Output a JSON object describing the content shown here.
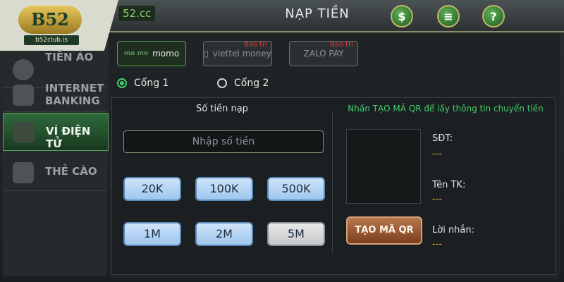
{
  "header": {
    "url_text": "52.cc",
    "title": "NẠP TIỀN",
    "icons": [
      "dollar-shield-icon",
      "list-icon",
      "help-icon"
    ]
  },
  "logo": {
    "brand": "B52",
    "site": "b52club.is"
  },
  "sidebar": {
    "items": [
      {
        "label": "TIỀN ẢO",
        "icon": "bitcoin-icon",
        "active": false
      },
      {
        "label": "INTERNET BANKING",
        "icon": "phone-banking-icon",
        "active": false
      },
      {
        "label": "VÍ ĐIỆN TỬ",
        "icon": "wallet-icon",
        "active": true
      },
      {
        "label": "THẺ CÀO",
        "icon": "card-icon",
        "active": false
      }
    ]
  },
  "wallets": [
    {
      "label": "momo",
      "logo_text": "mo mo",
      "status": "",
      "active": true
    },
    {
      "label": "viettel money",
      "status": "Bảo trì",
      "active": false
    },
    {
      "label": "ZALO PAY",
      "status": "Bảo trì",
      "active": false
    }
  ],
  "gates": [
    {
      "label": "Cổng 1",
      "selected": true
    },
    {
      "label": "Cổng 2",
      "selected": false
    }
  ],
  "form": {
    "amount_label": "Số tiền nạp",
    "amount_placeholder": "Nhập số tiền",
    "chips": [
      {
        "label": "20K",
        "enabled": true
      },
      {
        "label": "100K",
        "enabled": true
      },
      {
        "label": "500K",
        "enabled": true
      },
      {
        "label": "1M",
        "enabled": true
      },
      {
        "label": "2M",
        "enabled": true
      },
      {
        "label": "5M",
        "enabled": false
      }
    ]
  },
  "qr": {
    "instruction": "Nhấn TẠO MÃ QR để lấy thông tin chuyển tiền",
    "button": "TẠO MÃ QR",
    "fields": [
      {
        "label": "SĐT:",
        "value": "---"
      },
      {
        "label": "Tên TK:",
        "value": "---"
      },
      {
        "label": "Lời nhắn:",
        "value": "---"
      }
    ]
  },
  "colors": {
    "accent_green": "#3fd06a",
    "value_gold": "#e0b232",
    "chip_blue": "#9fc7ef"
  }
}
